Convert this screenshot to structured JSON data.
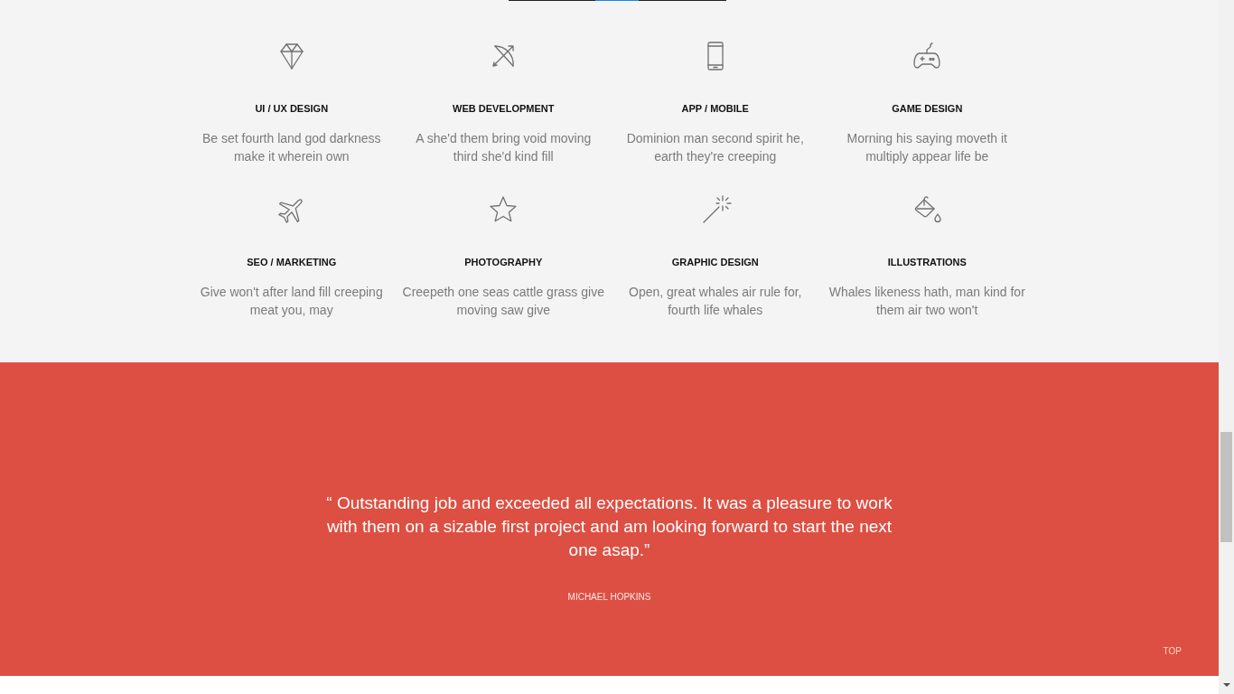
{
  "services": [
    {
      "title": "UI / UX DESIGN",
      "description": "Be set fourth land god darkness\nmake it wherein own"
    },
    {
      "title": "WEB DEVELOPMENT",
      "description": "A she'd them bring void moving\nthird she'd kind fill"
    },
    {
      "title": "APP / MOBILE",
      "description": "Dominion man second spirit he,\nearth they're creeping"
    },
    {
      "title": "GAME DESIGN",
      "description": "Morning his saying moveth it\nmultiply appear life be"
    },
    {
      "title": "SEO / MARKETING",
      "description": "Give won't after land fill creeping\nmeat you, may"
    },
    {
      "title": "PHOTOGRAPHY",
      "description": "Creepeth one seas cattle grass give\nmoving saw give"
    },
    {
      "title": "GRAPHIC DESIGN",
      "description": "Open, great whales air rule for,\nfourth life whales"
    },
    {
      "title": "ILLUSTRATIONS",
      "description": "Whales likeness hath, man kind for\nthem air two won't"
    }
  ],
  "testimonial": {
    "quote": "“ Outstanding job and exceeded all expectations. It was a pleasure to work with them on a sizable first project and am looking forward to start the next one asap.”",
    "author": "MICHAEL HOPKINS"
  },
  "back_to_top": {
    "label": "TOP"
  }
}
